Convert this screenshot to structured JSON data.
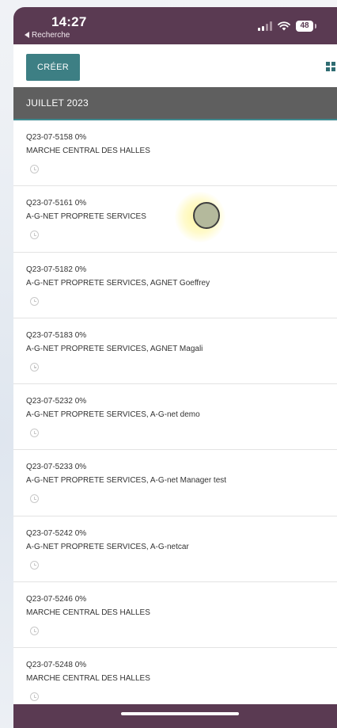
{
  "status_bar": {
    "time": "14:27",
    "back_label": "Recherche",
    "battery": "48"
  },
  "toolbar": {
    "create_label": "CRÉER",
    "view_icon": "grid-icon"
  },
  "group": {
    "label": "JUILLET 2023"
  },
  "items": [
    {
      "ref": "Q23-07-5158 0%",
      "partner": "MARCHE CENTRAL DES HALLES"
    },
    {
      "ref": "Q23-07-5161 0%",
      "partner": "A-G-NET PROPRETE SERVICES"
    },
    {
      "ref": "Q23-07-5182 0%",
      "partner": "A-G-NET PROPRETE SERVICES, AGNET Goeffrey"
    },
    {
      "ref": "Q23-07-5183 0%",
      "partner": "A-G-NET PROPRETE SERVICES, AGNET Magali"
    },
    {
      "ref": "Q23-07-5232 0%",
      "partner": "A-G-NET PROPRETE SERVICES, A-G-net demo"
    },
    {
      "ref": "Q23-07-5233 0%",
      "partner": "A-G-NET PROPRETE SERVICES, A-G-net Manager test"
    },
    {
      "ref": "Q23-07-5242 0%",
      "partner": "A-G-NET PROPRETE SERVICES, A-G-netcar"
    },
    {
      "ref": "Q23-07-5246 0%",
      "partner": "MARCHE CENTRAL DES HALLES"
    },
    {
      "ref": "Q23-07-5248 0%",
      "partner": "MARCHE CENTRAL DES HALLES"
    }
  ],
  "colors": {
    "status_bar": "#5a3a52",
    "accent": "#3d7f84",
    "group_header": "#5f5f5f"
  }
}
